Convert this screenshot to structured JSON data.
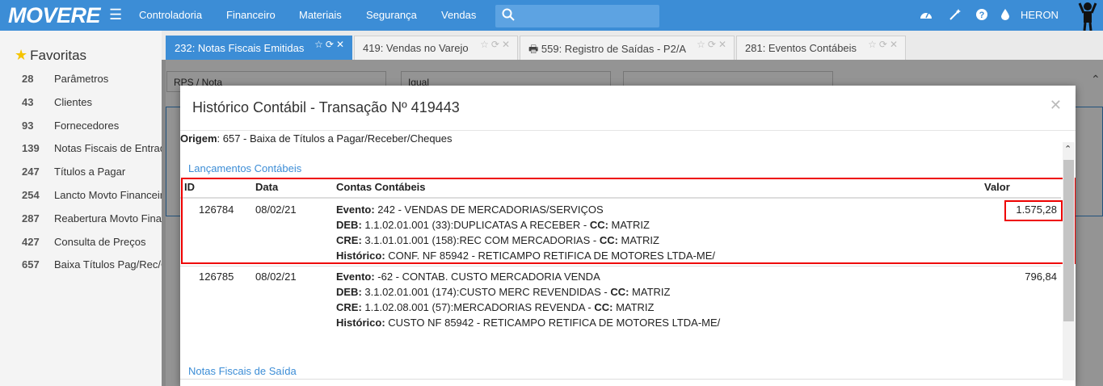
{
  "brand": "MOVERE",
  "nav": [
    "Controladoria",
    "Financeiro",
    "Materiais",
    "Segurança",
    "Vendas"
  ],
  "user": "HERON",
  "sidebar": {
    "title": "Favoritas",
    "items": [
      {
        "num": "28",
        "label": "Parâmetros"
      },
      {
        "num": "43",
        "label": "Clientes"
      },
      {
        "num": "93",
        "label": "Fornecedores"
      },
      {
        "num": "139",
        "label": "Notas Fiscais de Entrada"
      },
      {
        "num": "247",
        "label": "Títulos a Pagar"
      },
      {
        "num": "254",
        "label": "Lancto Movto Financeiro"
      },
      {
        "num": "287",
        "label": "Reabertura Movto Financeiro"
      },
      {
        "num": "427",
        "label": "Consulta de Preços"
      },
      {
        "num": "657",
        "label": "Baixa Títulos Pag/Rec/Cheques"
      }
    ]
  },
  "tabs": [
    {
      "label": "232: Notas Fiscais Emitidas",
      "active": true
    },
    {
      "label": "419: Vendas no Varejo",
      "active": false
    },
    {
      "label": "559: Registro de Saídas - P2/A",
      "active": false
    },
    {
      "label": "281: Eventos Contábeis",
      "active": false
    }
  ],
  "background": {
    "select1": "RPS / Nota",
    "select2": "Igual"
  },
  "modal": {
    "title": "Histórico Contábil - Transação Nº 419443",
    "origem_label": "Origem",
    "origem_value": ": 657 - Baixa de Títulos a Pagar/Receber/Cheques",
    "section1": "Lançamentos Contábeis",
    "section2": "Notas Fiscais de Saída",
    "columns": {
      "id": "ID",
      "data": "Data",
      "contas": "Contas Contábeis",
      "valor": "Valor"
    },
    "rows": [
      {
        "id": "126784",
        "data": "08/02/21",
        "valor": "1.575,28",
        "evento_label": "Evento:",
        "evento": " 242 - VENDAS DE MERCADORIAS/SERVIÇOS",
        "deb_label": "DEB:",
        "deb": " 1.1.02.01.001 (33):DUPLICATAS A RECEBER - ",
        "deb_cc_label": "CC:",
        "deb_cc": " MATRIZ",
        "cre_label": "CRE:",
        "cre": " 3.1.01.01.001 (158):REC COM MERCADORIAS - ",
        "cre_cc_label": "CC:",
        "cre_cc": " MATRIZ",
        "hist_label": "Histórico:",
        "hist": " CONF. NF 85942 - RETICAMPO RETIFICA DE MOTORES LTDA-ME/"
      },
      {
        "id": "126785",
        "data": "08/02/21",
        "valor": "796,84",
        "evento_label": "Evento:",
        "evento": " -62 - CONTAB. CUSTO MERCADORIA VENDA",
        "deb_label": "DEB:",
        "deb": " 3.1.02.01.001 (174):CUSTO MERC REVENDIDAS - ",
        "deb_cc_label": "CC:",
        "deb_cc": " MATRIZ",
        "cre_label": "CRE:",
        "cre": " 1.1.02.08.001 (57):MERCADORIAS REVENDA - ",
        "cre_cc_label": "CC:",
        "cre_cc": " MATRIZ",
        "hist_label": "Histórico:",
        "hist": " CUSTO NF 85942 - RETICAMPO RETIFICA DE MOTORES LTDA-ME/"
      }
    ]
  },
  "colors": {
    "topbar": "#3c8dd6",
    "highlight": "#e00000",
    "link": "#3c8dd6"
  }
}
